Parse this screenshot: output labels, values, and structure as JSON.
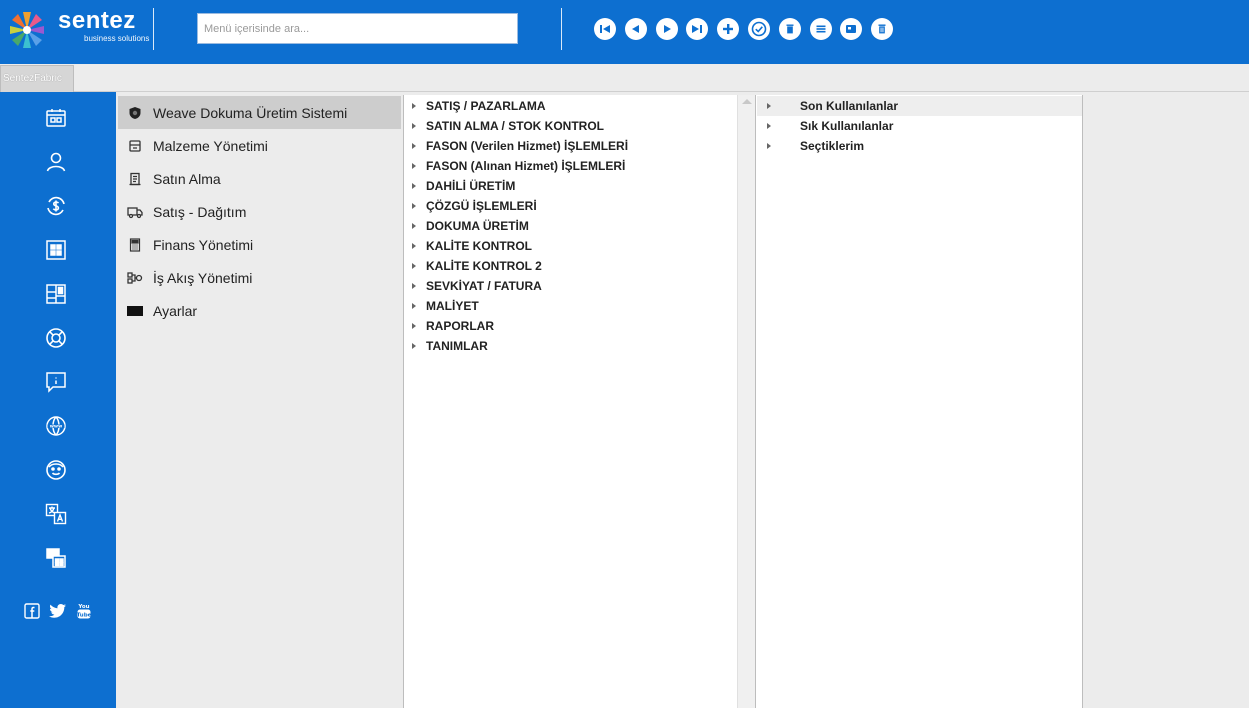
{
  "brand": {
    "name": "sentez",
    "tagline": "business solutions"
  },
  "search": {
    "placeholder": "Menü içerisinde ara...",
    "value": ""
  },
  "toolbar": {
    "buttons": [
      "first-icon",
      "previous-icon",
      "next-icon",
      "last-icon",
      "add-icon",
      "approve-icon",
      "delete-icon",
      "list-icon",
      "save-icon",
      "trash-icon"
    ]
  },
  "tab": {
    "label": "SentezFabric"
  },
  "rail": {
    "icons": [
      "calendar-icon",
      "user-icon",
      "currency-icon",
      "grid-icon",
      "dashboard-icon",
      "support-icon",
      "info-message-icon",
      "web-icon",
      "face-icon",
      "translate-icon",
      "layout-icon"
    ]
  },
  "social": [
    "facebook-icon",
    "twitter-icon",
    "youtube-icon"
  ],
  "modules": [
    {
      "label": "Weave Dokuma Üretim Sistemi",
      "icon": "shield-icon",
      "active": true
    },
    {
      "label": "Malzeme Yönetimi",
      "icon": "box-icon"
    },
    {
      "label": "Satın Alma",
      "icon": "document-icon"
    },
    {
      "label": "Satış - Dağıtım",
      "icon": "truck-icon"
    },
    {
      "label": "Finans Yönetimi",
      "icon": "calculator-icon"
    },
    {
      "label": "İş Akış Yönetimi",
      "icon": "workflow-icon"
    },
    {
      "label": "Ayarlar",
      "icon": "settings-icon"
    }
  ],
  "menu_tree": [
    "SATIŞ / PAZARLAMA",
    "SATIN ALMA / STOK KONTROL",
    "FASON (Verilen Hizmet) İŞLEMLERİ",
    "FASON (Alınan Hizmet) İŞLEMLERİ",
    "DAHİLİ ÜRETİM",
    "ÇÖZGÜ İŞLEMLERİ",
    "DOKUMA ÜRETİM",
    "KALİTE KONTROL",
    "KALİTE KONTROL 2",
    "SEVKİYAT / FATURA",
    "MALİYET",
    "RAPORLAR",
    "TANIMLAR"
  ],
  "favorites": [
    {
      "label": "Son Kullanılanlar",
      "active": true
    },
    {
      "label": "Sık Kullanılanlar"
    },
    {
      "label": "Seçtiklerim"
    }
  ],
  "colors": {
    "primary": "#0d6fd0",
    "panel": "#ececec",
    "selected": "#cdcdcd"
  }
}
